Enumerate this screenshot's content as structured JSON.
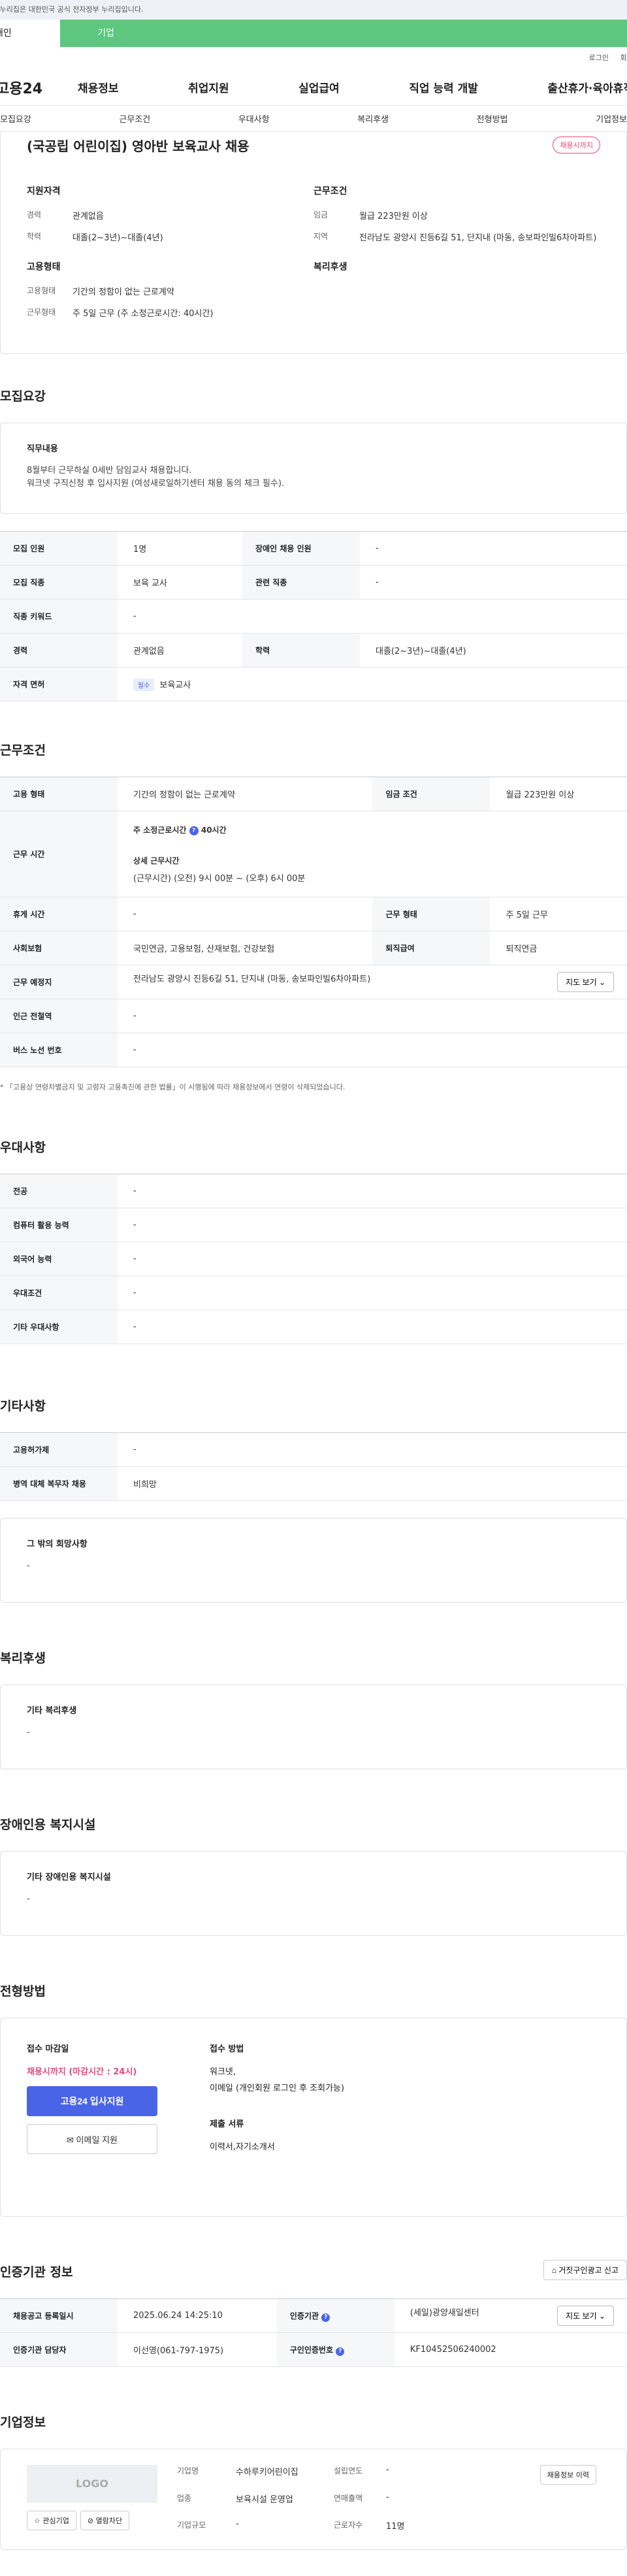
{
  "gov_bar": {
    "text": "이 누리집은 대한민국 공식 전자정부 누리집입니다."
  },
  "gnb_tabs": {
    "personal": "개인",
    "business": "기업"
  },
  "util": {
    "login": "로그인",
    "join": "회원가입"
  },
  "logo": "고용24",
  "main_nav": [
    "채용정보",
    "취업지원",
    "실업급여",
    "직업 능력 개발",
    "출산휴가·육아휴직"
  ],
  "sub_nav": [
    "모집요강",
    "근무조건",
    "우대사항",
    "복리후생",
    "전형방법",
    "기업정보"
  ],
  "job": {
    "title": "(국공립 어린이집) 영아반 보육교사 채용",
    "status_badge": "채용시까지",
    "summary": {
      "qual_head": "지원자격",
      "career_k": "경력",
      "career_v": "관계없음",
      "edu_k": "학력",
      "edu_v": "대졸(2~3년)~대졸(4년)",
      "emp_head": "고용형태",
      "emptype_k": "고용형태",
      "emptype_v": "기간의 정함이 없는 근로계약",
      "worktype_k": "근무형태",
      "worktype_v": "주 5일 근무 (주 소정근로시간: 40시간)",
      "cond_head": "근무조건",
      "wage_k": "임금",
      "wage_v": "월급 223만원 이상",
      "region_k": "지역",
      "region_v": "전라남도 광양시 진등6길 51, 단지내 (마동, 송보파인빌6차아파트)",
      "welfare_head": "복리후생"
    }
  },
  "recruit": {
    "title": "모집요강",
    "duty_head": "직무내용",
    "duty_text": "8월부터 근무하실 0세반 담임교사 채용합니다.\n워크넷 구직신청 후 입사지원 (여성새로일하기센터 채용 동의 체크 필수).",
    "rows": [
      {
        "k1": "모집 인원",
        "v1": "1명",
        "k2": "장애인 채용 인원",
        "v2": "-"
      },
      {
        "k1": "모집 직종",
        "v1": "보육 교사",
        "k2": "관련 직종",
        "v2": "-"
      },
      {
        "k1": "직종 키워드",
        "v1": "-"
      },
      {
        "k1": "경력",
        "v1": "관계없음",
        "k2": "학력",
        "v2": "대졸(2~3년)~대졸(4년)"
      },
      {
        "k1": "자격 면허",
        "tag": "필수",
        "v1": "보육교사"
      }
    ]
  },
  "conditions": {
    "title": "근무조건",
    "emp_k": "고용 형태",
    "emp_v": "기간의 정함이 없는 근로계약",
    "wage_k": "임금 조건",
    "wage_v": "월급 223만원 이상",
    "hours_k": "근무 시간",
    "hours_week_label": "주 소정근로시간",
    "hours_week_value": "40시간",
    "hours_detail_label": "상세 근무시간",
    "hours_detail_value": "(근무시간) (오전) 9시 00분 ~ (오후) 6시 00분",
    "break_k": "휴게 시간",
    "break_v": "-",
    "form_k": "근무 형태",
    "form_v": "주 5일 근무",
    "ins_k": "사회보험",
    "ins_v": "국민연금, 고용보험, 산재보험, 건강보험",
    "sev_k": "퇴직급여",
    "sev_v": "퇴직연금",
    "place_k": "근무 예정지",
    "place_v": "전라남도 광양시 진등6길 51, 단지내 (마동, 송보파인빌6차아파트)",
    "map_btn": "지도 보기",
    "subway_k": "인근 전철역",
    "subway_v": "-",
    "bus_k": "버스 노선 번호",
    "bus_v": "-",
    "note": "* 「고용상 연령차별금지 및 고령자 고용촉진에 관한 법률」이 시행됨에 따라 채용정보에서 연령이 삭제되었습니다."
  },
  "preference": {
    "title": "우대사항",
    "rows": [
      {
        "k": "전공",
        "v": "-"
      },
      {
        "k": "컴퓨터 활용 능력",
        "v": "-"
      },
      {
        "k": "외국어 능력",
        "v": "-"
      },
      {
        "k": "우대조건",
        "v": "-"
      },
      {
        "k": "기타 우대사항",
        "v": "-"
      }
    ]
  },
  "etc": {
    "title": "기타사항",
    "rows": [
      {
        "k": "고용허가제",
        "v": "-"
      },
      {
        "k": "병역 대체 복무자 채용",
        "v": "비희망"
      }
    ],
    "other_head": "그 밖의 희망사항",
    "other_v": "-"
  },
  "welfare": {
    "title": "복리후생",
    "head": "기타 복리후생",
    "v": "-"
  },
  "disability": {
    "title": "장애인용 복지시설",
    "head": "기타 장애인용 복지시설",
    "v": "-"
  },
  "process": {
    "title": "전형방법",
    "deadline_head": "접수 마감일",
    "deadline_v": "채용시까지 (마감시간 : 24시)",
    "apply_btn": "고용24 입사지원",
    "email_btn": "이메일 지원",
    "method_head": "접수 방법",
    "method_v1": "워크넷,",
    "method_v2": "이메일 (개인회원 로그인 후 조회가능)",
    "docs_head": "제출 서류",
    "docs_v": "이력서,자기소개서"
  },
  "agency": {
    "title": "인증기관 정보",
    "report_btn": "거짓구인광고 신고",
    "reg_k": "채용공고 등록일시",
    "reg_v": "2025.06.24 14:25:10",
    "org_k": "인증기관",
    "org_v": "(세일)광양새일센터",
    "map_btn": "지도 보기",
    "mgr_k": "인증기관 담당자",
    "mgr_v": "이선영(061-797-1975)",
    "no_k": "구인인증번호",
    "no_v": "KF10452506240002"
  },
  "company": {
    "title": "기업정보",
    "logo": "LOGO",
    "fav_btn": "관심기업",
    "block_btn": "열람차단",
    "name_k": "기업명",
    "name_v": "수하루키어린이집",
    "year_k": "설립연도",
    "year_v": "-",
    "biz_k": "업종",
    "biz_v": "보육시설 운영업",
    "sales_k": "연매출액",
    "sales_v": "-",
    "size_k": "기업규모",
    "size_v": "-",
    "emp_k": "근로자수",
    "emp_v": "11명",
    "history_btn": "채용정보 이력"
  }
}
